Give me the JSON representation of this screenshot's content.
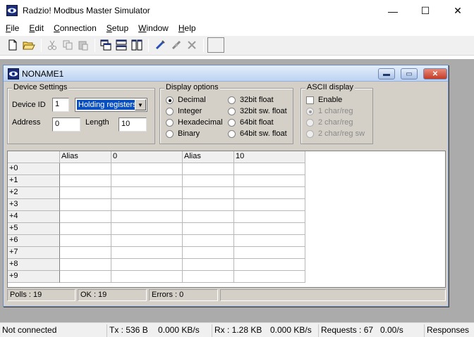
{
  "app": {
    "title": "Radzio! Modbus Master Simulator"
  },
  "window_controls": {
    "minimize": "—",
    "maximize": "☐",
    "close": "✕"
  },
  "menu": [
    {
      "first": "F",
      "rest": "ile"
    },
    {
      "first": "E",
      "rest": "dit"
    },
    {
      "first": "C",
      "rest": "onnection"
    },
    {
      "first": "S",
      "rest": "etup"
    },
    {
      "first": "W",
      "rest": "indow"
    },
    {
      "first": "H",
      "rest": "elp"
    }
  ],
  "toolbar": {
    "icons": [
      "new-file-icon",
      "open-folder-icon",
      "cut-icon",
      "copy-icon",
      "paste-icon",
      "cascade-icon",
      "tile-horizontal-icon",
      "tile-vertical-icon",
      "connect-icon",
      "disconnect-icon",
      "tools-icon",
      "blank-icon"
    ]
  },
  "child": {
    "title": "NONAME1",
    "device_settings": {
      "label": "Device Settings",
      "device_id_label": "Device ID",
      "device_id": "1",
      "register_type": "Holding registers",
      "address_label": "Address",
      "address": "0",
      "length_label": "Length",
      "length": "10"
    },
    "display_options": {
      "label": "Display options",
      "options": [
        "Decimal",
        "Integer",
        "Hexadecimal",
        "Binary",
        "32bit float",
        "32bit sw. float",
        "64bit float",
        "64bit sw. float"
      ],
      "selected": "Decimal"
    },
    "ascii_display": {
      "label": "ASCII display",
      "enable_label": "Enable",
      "options": [
        "1 char/reg",
        "2 char/reg",
        "2 char/reg sw"
      ],
      "selected": "1 char/reg"
    },
    "grid": {
      "headers": [
        "",
        "Alias",
        "0",
        "Alias",
        "10"
      ],
      "rows": [
        "+0",
        "+1",
        "+2",
        "+3",
        "+4",
        "+5",
        "+6",
        "+7",
        "+8",
        "+9"
      ]
    },
    "status": {
      "polls": "Polls : 19",
      "ok": "OK : 19",
      "errors": "Errors : 0"
    }
  },
  "statusbar": {
    "connection": "Not connected",
    "tx": "Tx : 536 B",
    "tx_rate": "0.000 KB/s",
    "rx": "Rx : 1.28 KB",
    "rx_rate": "0.000 KB/s",
    "requests": "Requests : 67",
    "req_rate": "0.00/s",
    "responses": "Responses"
  }
}
